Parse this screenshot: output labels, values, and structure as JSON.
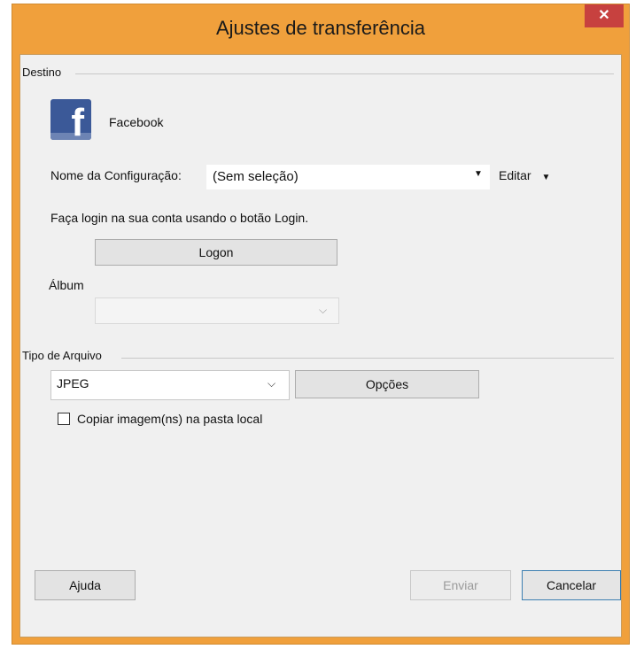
{
  "window": {
    "title": "Ajustes de transferência",
    "close_glyph": "✕"
  },
  "destination": {
    "group_label": "Destino",
    "service_name": "Facebook",
    "service_icon": "facebook-icon",
    "config_label": "Nome da Configuração:",
    "config_value": "(Sem seleção)",
    "edit_label": "Editar",
    "login_instruction": "Faça login na sua conta usando o botão Login.",
    "logon_button": "Logon",
    "album_label": "Álbum",
    "album_value": ""
  },
  "file_type": {
    "group_label": "Tipo de Arquivo",
    "selected": "JPEG",
    "options_button": "Opções",
    "copy_checkbox_label": "Copiar imagem(ns) na pasta local",
    "copy_checked": false
  },
  "footer": {
    "help_button": "Ajuda",
    "send_button": "Enviar",
    "cancel_button": "Cancelar"
  },
  "colors": {
    "title_bar": "#f0a03c",
    "close_button": "#c7413f",
    "facebook_blue": "#3b5998",
    "dialog_bg": "#f0f0f0"
  }
}
